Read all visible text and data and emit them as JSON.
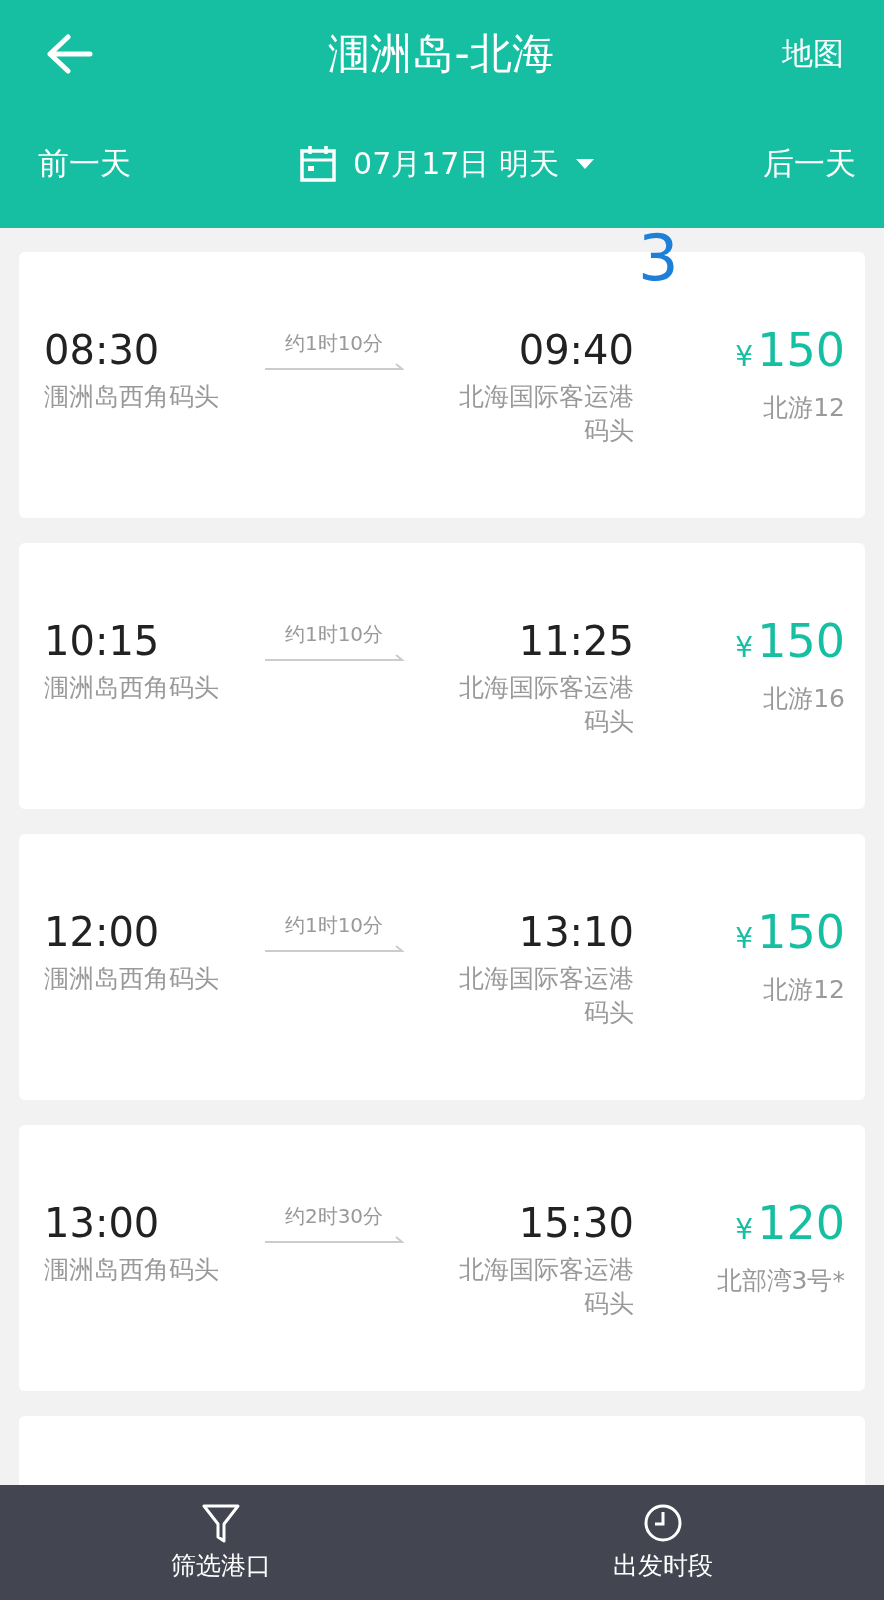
{
  "header": {
    "title": "涠洲岛-北海",
    "map_link": "地图",
    "prev_day": "前一天",
    "date": "07月17日 明天",
    "next_day": "后一天"
  },
  "annotation": "3",
  "trips": [
    {
      "depart_time": "08:30",
      "depart_port": "涠洲岛西角码头",
      "duration": "约1时10分",
      "arrive_time": "09:40",
      "arrive_port": "北海国际客运港码头",
      "currency": "¥",
      "price": "150",
      "boat": "北游12"
    },
    {
      "depart_time": "10:15",
      "depart_port": "涠洲岛西角码头",
      "duration": "约1时10分",
      "arrive_time": "11:25",
      "arrive_port": "北海国际客运港码头",
      "currency": "¥",
      "price": "150",
      "boat": "北游16"
    },
    {
      "depart_time": "12:00",
      "depart_port": "涠洲岛西角码头",
      "duration": "约1时10分",
      "arrive_time": "13:10",
      "arrive_port": "北海国际客运港码头",
      "currency": "¥",
      "price": "150",
      "boat": "北游12"
    },
    {
      "depart_time": "13:00",
      "depart_port": "涠洲岛西角码头",
      "duration": "约2时30分",
      "arrive_time": "15:30",
      "arrive_port": "北海国际客运港码头",
      "currency": "¥",
      "price": "120",
      "boat": "北部湾3号*"
    }
  ],
  "bottom_bar": [
    {
      "kind": "filter",
      "label": "筛选港口"
    },
    {
      "kind": "clock",
      "label": "出发时段"
    }
  ]
}
